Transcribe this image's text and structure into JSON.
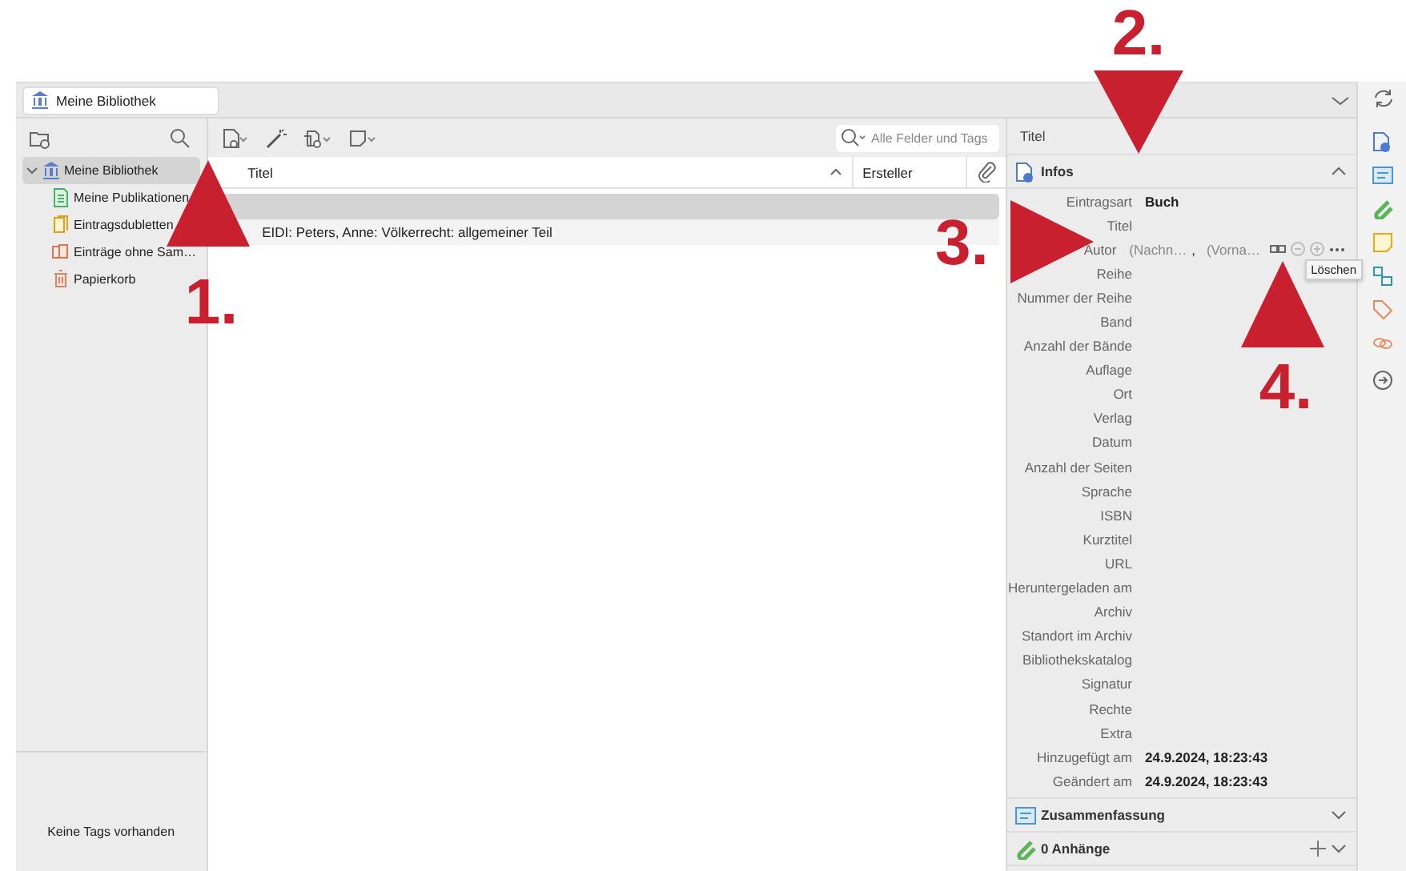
{
  "tabs": [
    {
      "label": "Meine Bibliothek",
      "selected": true
    }
  ],
  "collections": [
    {
      "label": "Meine Bibliothek",
      "kind": "library",
      "selected": true,
      "expanded": true,
      "children": [
        {
          "label": "Meine Publikationen",
          "kind": "publications",
          "selected": false
        },
        {
          "label": "Eintragsdubletten",
          "kind": "duplicates",
          "selected": false
        },
        {
          "label": "Einträge ohne Sam…",
          "kind": "unfiled",
          "selected": false
        },
        {
          "label": "Papierkorb",
          "kind": "trash",
          "selected": false
        }
      ]
    }
  ],
  "tag_pane": {
    "message": "Keine Tags vorhanden"
  },
  "search": {
    "placeholder": "Alle Felder und Tags"
  },
  "table": {
    "columns": [
      {
        "label": "Titel",
        "sorted": true
      },
      {
        "label": "Ersteller",
        "sorted": false
      }
    ],
    "rows": [
      {
        "selected": true
      },
      {
        "title": "EIDI: Peters, Anne: Völkerrecht: allgemeiner Teil",
        "selected": false
      }
    ]
  },
  "item_pane": {
    "header": "Titel",
    "sections": [
      {
        "title": "Infos",
        "kind": "info",
        "expanded": true,
        "fields": [
          {
            "label": "Eintragsart",
            "value": "Buch"
          },
          {
            "label": "Titel"
          },
          {
            "label": "Autor",
            "kind": "creator",
            "last": "(Nachn…",
            "separator": ",",
            "first": "(Vorna…"
          },
          {
            "label": "Reihe"
          },
          {
            "label": "Nummer der Reihe"
          },
          {
            "label": "Band"
          },
          {
            "label": "Anzahl der Bände"
          },
          {
            "label": "Auflage"
          },
          {
            "label": "Ort"
          },
          {
            "label": "Verlag"
          },
          {
            "label": "Datum"
          },
          {
            "label": "Anzahl der Seiten"
          },
          {
            "label": "Sprache"
          },
          {
            "label": "ISBN"
          },
          {
            "label": "Kurztitel"
          },
          {
            "label": "URL"
          },
          {
            "label": "Heruntergeladen am"
          },
          {
            "label": "Archiv"
          },
          {
            "label": "Standort im Archiv"
          },
          {
            "label": "Bibliothekskatalog"
          },
          {
            "label": "Signatur"
          },
          {
            "label": "Rechte"
          },
          {
            "label": "Extra"
          },
          {
            "label": "Hinzugefügt am",
            "value": "24.9.2024, 18:23:43"
          },
          {
            "label": "Geändert am",
            "value": "24.9.2024, 18:23:43"
          }
        ]
      },
      {
        "title": "Zusammenfassung",
        "kind": "abstract",
        "expanded": false
      },
      {
        "title": "0 Anhänge",
        "kind": "attachments",
        "expanded": false
      }
    ]
  },
  "tooltip": "Löschen",
  "annotations": [
    {
      "label": "1.",
      "kind": "up"
    },
    {
      "label": "2.",
      "kind": "down"
    },
    {
      "label": "3.",
      "kind": "right"
    },
    {
      "label": "4.",
      "kind": "up"
    }
  ]
}
